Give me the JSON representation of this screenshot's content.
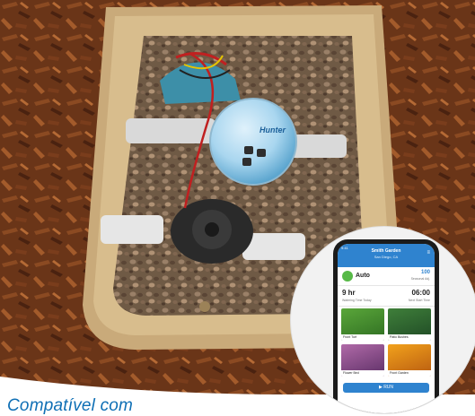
{
  "caption": "Compatível com",
  "app": {
    "status_time": "9:41",
    "title": "Smith Garden",
    "subtitle": "San Diego, CA",
    "mode_label": "Auto",
    "mode_value": "100",
    "mode_value_sub": "Seasonal Adj.",
    "left_value": "9 hr",
    "left_sub": "Watering Time Today",
    "right_value": "06:00",
    "right_sub": "Next Start Time",
    "tiles": [
      {
        "label": "Front Turf"
      },
      {
        "label": "Patio Bushes"
      },
      {
        "label": "Flower Bed"
      },
      {
        "label": "Front Garden"
      }
    ],
    "run_label": "▶ RUN"
  },
  "colors": {
    "accent": "#2f83cf",
    "caption": "#0f6fb5",
    "mode_dot": "#57b947"
  }
}
